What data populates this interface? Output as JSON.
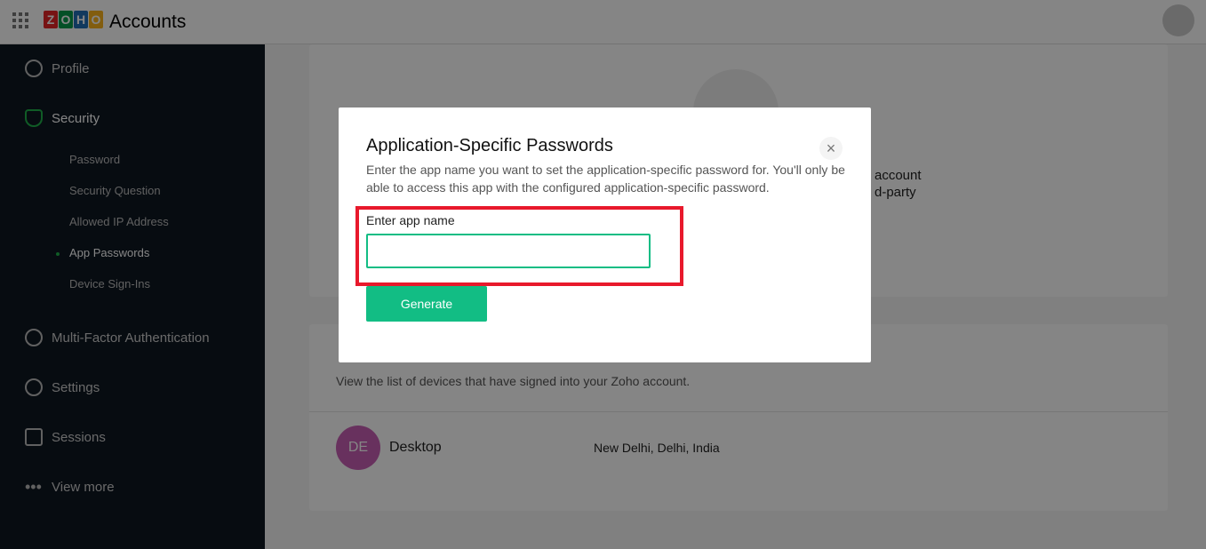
{
  "header": {
    "app_title": "Accounts",
    "logo_letters": [
      "Z",
      "O",
      "H",
      "O"
    ],
    "logo_colors": [
      "#e42527",
      "#089949",
      "#226db4",
      "#f9b21d"
    ]
  },
  "sidebar": {
    "items": [
      {
        "label": "Profile",
        "icon": "profile-icon"
      },
      {
        "label": "Security",
        "icon": "shield-icon",
        "active": true,
        "subitems": [
          {
            "label": "Password"
          },
          {
            "label": "Security Question"
          },
          {
            "label": "Allowed IP Address"
          },
          {
            "label": "App Passwords",
            "active": true
          },
          {
            "label": "Device Sign-Ins"
          }
        ]
      },
      {
        "label": "Multi-Factor Authentication",
        "icon": "shield-check-icon"
      },
      {
        "label": "Settings",
        "icon": "gear-icon"
      },
      {
        "label": "Sessions",
        "icon": "calendar-icon"
      },
      {
        "label": "View more",
        "icon": "more-dots-icon"
      }
    ]
  },
  "background": {
    "partial_line1": "account",
    "partial_line2": "d-party",
    "devices_subtitle": "View the list of devices that have signed into your Zoho account.",
    "device": {
      "initials": "DE",
      "name": "Desktop",
      "location": "New Delhi, Delhi, India"
    }
  },
  "modal": {
    "title": "Application-Specific Passwords",
    "description": "Enter the app name you want to set the application-specific password for. You'll only be able to access this app with the configured application-specific password.",
    "field_label": "Enter app name",
    "field_value": "",
    "generate_label": "Generate",
    "close_symbol": "×"
  },
  "colors": {
    "accent": "#12bd84",
    "highlight": "#e8192c",
    "security_green": "#1fb14a"
  }
}
